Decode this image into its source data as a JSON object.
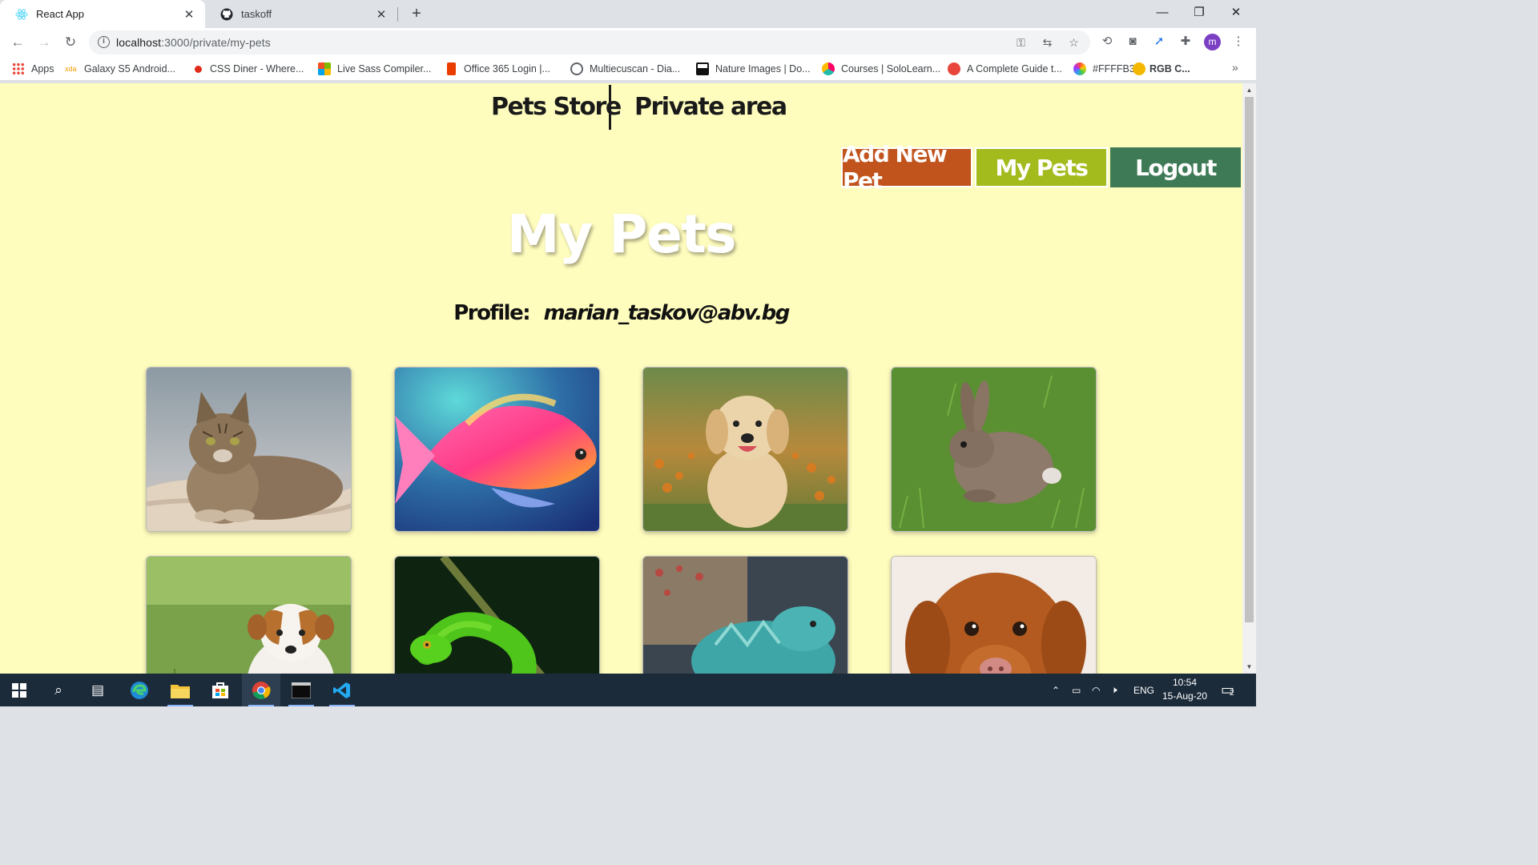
{
  "browser": {
    "tabs": [
      {
        "title": "React App",
        "active": true,
        "icon": "react-icon"
      },
      {
        "title": "taskoff",
        "active": false,
        "icon": "github-icon"
      }
    ],
    "url_host": "localhost",
    "url_path": ":3000/private/my-pets",
    "bookmarks": [
      {
        "label": "Apps",
        "icon": "apps-grid-icon"
      },
      {
        "label": "Galaxy S5 Android...",
        "icon": "xda-icon"
      },
      {
        "label": "CSS Diner - Where...",
        "icon": "css-diner-icon"
      },
      {
        "label": "Live Sass Compiler...",
        "icon": "ms-icon"
      },
      {
        "label": "Office 365 Login |...",
        "icon": "office-icon"
      },
      {
        "label": "Multiecuscan - Dia...",
        "icon": "globe-icon"
      },
      {
        "label": "Nature Images | Do...",
        "icon": "nature-icon"
      },
      {
        "label": "Courses | SoloLearn...",
        "icon": "sololearn-icon"
      },
      {
        "label": "A Complete Guide t...",
        "icon": "guide-icon"
      },
      {
        "label": "#FFFFB3",
        "icon": "color-icon"
      },
      {
        "label": "RGB C...",
        "icon": "rgb-icon",
        "bold": true
      }
    ],
    "profile_initial": "m"
  },
  "site": {
    "nav": {
      "store": "Pets Store",
      "private": "Private area"
    },
    "actions": {
      "add": "Add New Pet",
      "my": "My Pets",
      "logout": "Logout"
    },
    "title": "My Pets",
    "profile_label": "Profile:",
    "profile_email": "marian_taskov@abv.bg",
    "pets": [
      {
        "animal": "cat-photo"
      },
      {
        "animal": "fish-photo"
      },
      {
        "animal": "puppy-photo"
      },
      {
        "animal": "rabbit-photo"
      },
      {
        "animal": "terrier-photo"
      },
      {
        "animal": "snake-photo"
      },
      {
        "animal": "iguana-photo"
      },
      {
        "animal": "retriever-photo"
      }
    ]
  },
  "taskbar": {
    "language": "ENG",
    "time": "10:54",
    "date": "15-Aug-20",
    "notifications": "2"
  },
  "colors": {
    "page_bg": "#fffdbe",
    "add_button": "#c1531c",
    "my_pets_button": "#a4bb1d",
    "logout_button": "#3d7a55"
  }
}
